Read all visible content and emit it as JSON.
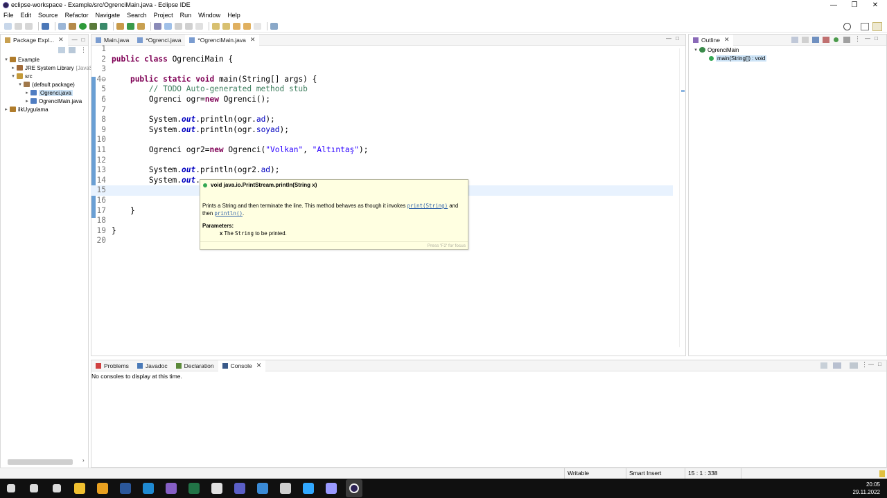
{
  "window": {
    "title": "eclipse-workspace - Example/src/OgrenciMain.java - Eclipse IDE",
    "min_glyph": "—",
    "restore_glyph": "❐",
    "close_glyph": "✕"
  },
  "menu": [
    "File",
    "Edit",
    "Source",
    "Refactor",
    "Navigate",
    "Search",
    "Project",
    "Run",
    "Window",
    "Help"
  ],
  "package_explorer": {
    "tab_label": "Package Expl...",
    "tree": [
      {
        "label": "Example",
        "level": 0,
        "arrow": "▾",
        "icon_color": "#b07c2c"
      },
      {
        "label": "JRE System Library",
        "suffix": "[JavaSE]",
        "level": 1,
        "arrow": "▸",
        "icon_color": "#a26b3a"
      },
      {
        "label": "src",
        "level": 1,
        "arrow": "▾",
        "icon_color": "#c49a3a"
      },
      {
        "label": "(default package)",
        "level": 2,
        "arrow": "▾",
        "icon_color": "#a0784a"
      },
      {
        "label": "Ogrenci.java",
        "level": 3,
        "arrow": "▸",
        "icon_color": "#4f7dc2",
        "selected": true
      },
      {
        "label": "OgrenciMain.java",
        "level": 3,
        "arrow": "▸",
        "icon_color": "#4f7dc2"
      },
      {
        "label": "ilkUygulama",
        "level": 0,
        "arrow": "▸",
        "icon_color": "#b07c2c"
      }
    ]
  },
  "editor_tabs": [
    {
      "label": "Main.java",
      "active": false,
      "closable": false
    },
    {
      "label": "*Ogrenci.java",
      "active": false,
      "closable": false
    },
    {
      "label": "*OgrenciMain.java",
      "active": true,
      "closable": true
    }
  ],
  "code": [
    {
      "n": "1",
      "html": ""
    },
    {
      "n": "2",
      "html": "<span class=\"kw\">public class</span> OgrenciMain {"
    },
    {
      "n": "3",
      "html": ""
    },
    {
      "n": "4⊖",
      "html": "    <span class=\"kw\">public static void</span> main(String[] args) {"
    },
    {
      "n": "5",
      "html": "        <span class=\"cmt\">// TODO Auto-generated method stub</span>"
    },
    {
      "n": "6",
      "html": "        Ogrenci ogr=<span class=\"kw\">new</span> Ogrenci();"
    },
    {
      "n": "7",
      "html": ""
    },
    {
      "n": "8",
      "html": "        System.<span class=\"fld\">out</span>.println(ogr.<span class=\"fld2\">ad</span>);"
    },
    {
      "n": "9",
      "html": "        System.<span class=\"fld\">out</span>.println(ogr.<span class=\"fld2\">soyad</span>);"
    },
    {
      "n": "10",
      "html": ""
    },
    {
      "n": "11",
      "html": "        Ogrenci ogr2=<span class=\"kw\">new</span> Ogrenci(<span class=\"str\">\"Volkan\"</span>, <span class=\"str\">\"Altıntaş\"</span>);"
    },
    {
      "n": "12",
      "html": ""
    },
    {
      "n": "13",
      "html": "        System.<span class=\"fld\">out</span>.println(ogr2.<span class=\"fld2\">ad</span>);"
    },
    {
      "n": "14",
      "html": "        System.<span class=\"fld\">out</span>."
    },
    {
      "n": "15",
      "html": "",
      "current": true
    },
    {
      "n": "16",
      "html": ""
    },
    {
      "n": "17",
      "html": "    }"
    },
    {
      "n": "18",
      "html": ""
    },
    {
      "n": "19",
      "html": "}"
    },
    {
      "n": "20",
      "html": ""
    }
  ],
  "hover": {
    "signature": "void java.io.PrintStream.println(String x)",
    "desc_start": "Prints a String and then terminate the line. This method behaves as though it invokes ",
    "link1": "print(String)",
    "desc_mid": " and then ",
    "link2": "println()",
    "desc_end": ".",
    "params_heading": "Parameters:",
    "param_name": "x",
    "param_pre": " The ",
    "param_type": "String",
    "param_post": " to be printed.",
    "footer": "Press 'F2' for focus"
  },
  "outline": {
    "tab_label": "Outline",
    "class_name": "OgrenciMain",
    "method": "main(String[]) : void"
  },
  "console": {
    "tabs": [
      {
        "label": "Problems",
        "active": false,
        "icon_color": "#d04040"
      },
      {
        "label": "Javadoc",
        "active": false,
        "icon_color": "#4a7ab8"
      },
      {
        "label": "Declaration",
        "active": false,
        "icon_color": "#5b8a3a"
      },
      {
        "label": "Console",
        "active": true,
        "icon_color": "#3a5a8a"
      }
    ],
    "message": "No consoles to display at this time."
  },
  "status": {
    "writable": "Writable",
    "insert_mode": "Smart Insert",
    "position": "15 : 1 : 338"
  },
  "taskbar": {
    "time": "20:05",
    "date": "29.11.2022",
    "apps": [
      {
        "name": "windows-start-icon",
        "color": "#ffffff"
      },
      {
        "name": "search-icon",
        "color": "#ffffff"
      },
      {
        "name": "task-view-icon",
        "color": "#ffffff"
      },
      {
        "name": "file-explorer-icon",
        "color": "#f0c030"
      },
      {
        "name": "chrome-icon",
        "color": "#e8a020"
      },
      {
        "name": "word-icon",
        "color": "#2b579a"
      },
      {
        "name": "vscode-icon",
        "color": "#1f8ad2"
      },
      {
        "name": "visual-studio-icon",
        "color": "#865fc5"
      },
      {
        "name": "excel-icon",
        "color": "#217346"
      },
      {
        "name": "obs-icon",
        "color": "#e0e0e0"
      },
      {
        "name": "teams-icon",
        "color": "#5b5fc7"
      },
      {
        "name": "unknown-app-icon",
        "color": "#3a8ad6"
      },
      {
        "name": "app-icon",
        "color": "#cfcfcf"
      },
      {
        "name": "photoshop-icon",
        "color": "#31a8ff"
      },
      {
        "name": "after-effects-icon",
        "color": "#9999ff"
      },
      {
        "name": "eclipse-icon",
        "color": "#2c2255"
      }
    ]
  }
}
